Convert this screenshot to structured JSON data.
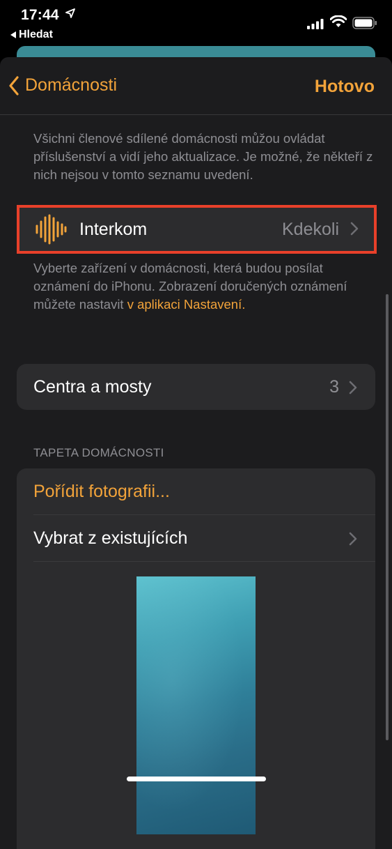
{
  "status_bar": {
    "time": "17:44",
    "back_app": "Hledat"
  },
  "nav": {
    "back_label": "Domácnosti",
    "done_label": "Hotovo"
  },
  "members_description": "Všichni členové sdílené domácnosti můžou ovládat příslušenství a vidí jeho aktualizace. Je možné, že někteří z nich nejsou v tomto seznamu uvedení.",
  "intercom": {
    "label": "Interkom",
    "value": "Kdekoli",
    "icon": "waveform-icon"
  },
  "notification_description": {
    "text": "Vyberte zařízení v domácnosti, která budou posílat oznámení do iPhonu. Zobrazení doručených oznámení můžete nastavit ",
    "link": "v aplikaci Nastavení."
  },
  "hubs": {
    "label": "Centra a mosty",
    "value": "3"
  },
  "wallpaper_section": {
    "header": "TAPETA DOMÁCNOSTI",
    "take_photo": "Pořídit fotografii...",
    "choose_existing": "Vybrat z existujících"
  },
  "colors": {
    "accent": "#f2a33a",
    "highlight": "#e8402a",
    "background": "#1c1c1e",
    "cell": "#2c2c2e"
  }
}
